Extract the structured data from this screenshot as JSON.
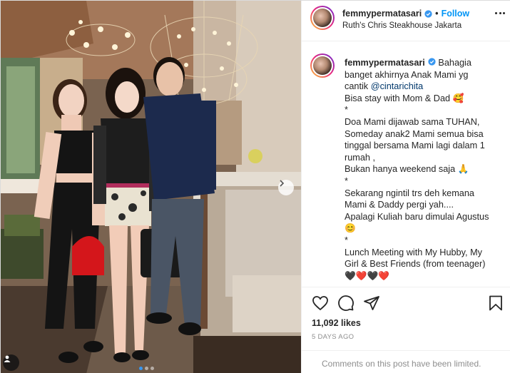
{
  "header": {
    "username": "femmypermatasari",
    "separator": "•",
    "follow_label": "Follow",
    "location": "Ruth's Chris Steakhouse Jakarta"
  },
  "caption": {
    "username": "femmypermatasari",
    "line1_text": "Bahagia",
    "lines": [
      "banget akhirnya Anak Mami yg",
      "cantik"
    ],
    "mention": "@cintarichita",
    "line_after": "Bisa stay with Mom & Dad 🥰",
    "star1": "*",
    "para2": [
      "Doa Mami dijawab sama TUHAN,",
      "Someday anak2 Mami semua bisa",
      "tinggal bersama Mami lagi dalam 1",
      "rumah ,",
      "Bukan hanya weekend saja 🙏"
    ],
    "star2": "*",
    "para3": [
      "Sekarang ngintil trs deh kemana",
      "Mami & Daddy pergi yah....",
      "Apalagi Kuliah baru dimulai Agustus",
      "😊"
    ],
    "star3": "*",
    "para4": [
      "Lunch Meeting with My Hubby, My",
      "Girl & Best Friends (from teenager)",
      "🖤❤️🖤❤️"
    ]
  },
  "actions": {
    "likes": "11,092 likes",
    "date": "5 DAYS AGO",
    "comments_disabled": "Comments on this post have been limited."
  },
  "colors": {
    "accent": "#0095f6",
    "verified": "#3897f0",
    "muted": "#8e8e8e"
  },
  "icons": [
    "heart-icon",
    "comment-icon",
    "share-icon",
    "bookmark-icon",
    "more-icon",
    "verified-icon",
    "chevron-right-icon",
    "user-tag-icon"
  ]
}
